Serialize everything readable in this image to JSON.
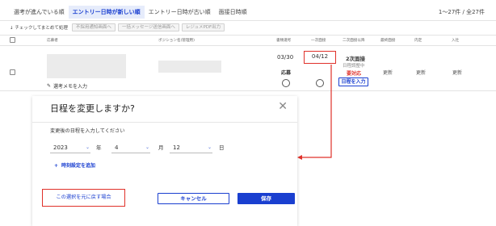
{
  "tabs": [
    {
      "label": "選考が進んでいる順"
    },
    {
      "label": "エントリー日時が新しい順"
    },
    {
      "label": "エントリー日時が古い順"
    },
    {
      "label": "面接日時順"
    }
  ],
  "count": "1〜27件 / 全27件",
  "toolbar": {
    "check_label": "チェックしてまとめて処理",
    "buttons": [
      "不採用通知画面へ",
      "一括メッセージ送信画面へ",
      "レジュメPDF出力"
    ]
  },
  "columns": [
    "応募者",
    "ポジション名(管理用)",
    "書類選考",
    "一次面接",
    "二次面接以降",
    "最終面接",
    "内定",
    "入社"
  ],
  "row": {
    "memo_label": "選考メモを入力",
    "doc_date": "03/30",
    "doc_status": "応募",
    "first_date": "04/12",
    "second_stage": "2次面接",
    "second_sub": "日程調整中",
    "second_alert": "要対応",
    "second_button": "日程を入力",
    "final": "更新",
    "offer": "更新",
    "join": "更新"
  },
  "modal": {
    "title": "日程を変更しますか?",
    "prompt": "変更後の日程を入力してください",
    "year_value": "2023",
    "year_unit": "年",
    "month_value": "4",
    "month_unit": "月",
    "day_value": "12",
    "day_unit": "日",
    "add_time": "時刻設定を追加",
    "revert_link": "この選択を元に戻す場合",
    "cancel": "キャンセル",
    "save": "保存"
  },
  "colors": {
    "accent": "#1a3fd0",
    "highlight": "#e0312a"
  },
  "icons": [
    "sort-down-icon",
    "memo-icon",
    "close-icon",
    "chevron-down-icon",
    "plus-icon"
  ]
}
